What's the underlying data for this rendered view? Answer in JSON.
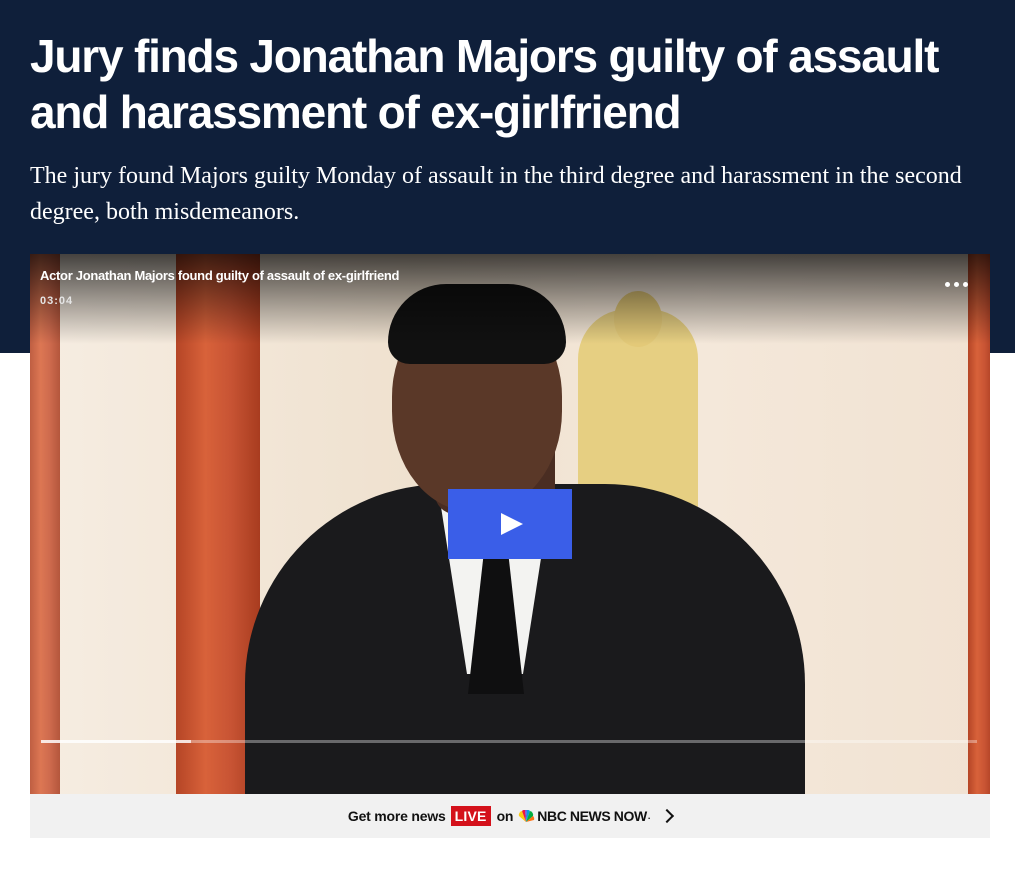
{
  "article": {
    "headline": "Jury finds Jonathan Majors guilty of assault and harassment of ex-girlfriend",
    "dek": "The jury found Majors guilty Monday of assault in the third degree and harassment in the second degree, both misdemeanors."
  },
  "video": {
    "title": "Actor Jonathan Majors found guilty of assault of ex-girlfriend",
    "duration": "03:04",
    "progress_fraction": 0.16,
    "icons": {
      "more": "more-icon",
      "play": "play-icon"
    },
    "colors": {
      "play_button": "#3a5ee8"
    }
  },
  "live_bar": {
    "lead": "Get more news",
    "badge": "LIVE",
    "connector": "on",
    "brand": "NBC NEWS NOW",
    "brand_suffix": ".",
    "icons": {
      "logo": "peacock-icon",
      "arrow": "chevron-right-icon"
    },
    "colors": {
      "badge": "#d4111b"
    }
  },
  "colors": {
    "hero_background": "#0f1f3a"
  }
}
